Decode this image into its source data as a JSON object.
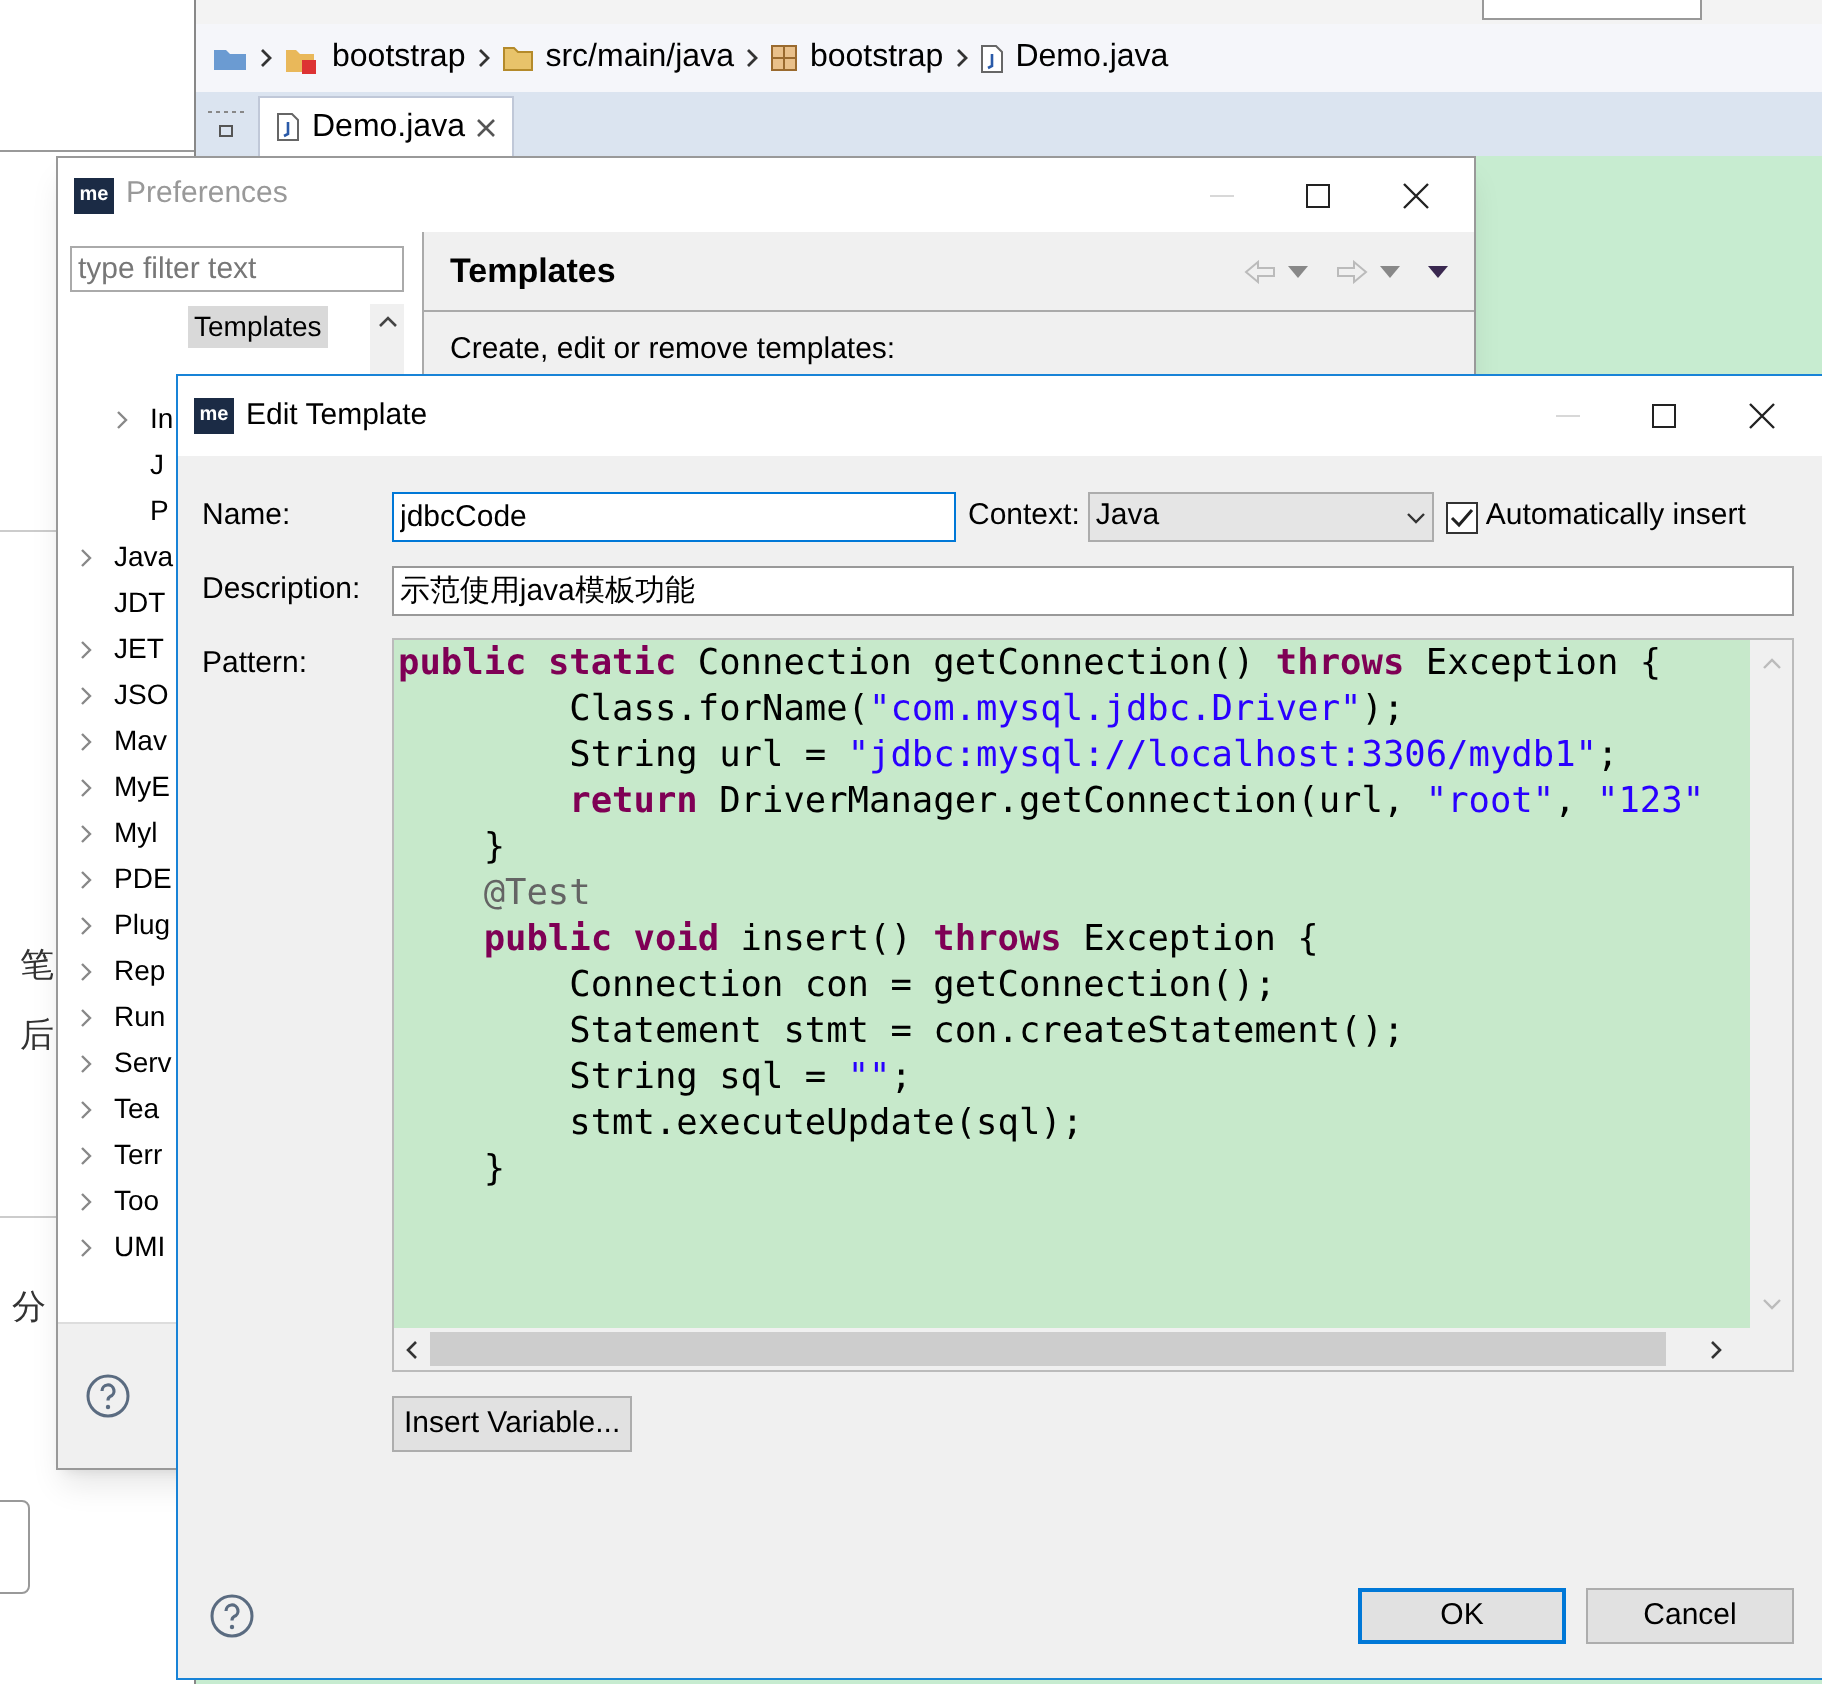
{
  "background_page": {
    "fragments": [
      "笔",
      "后",
      "分"
    ]
  },
  "editor": {
    "breadcrumb": [
      {
        "label": "bootstrap",
        "kind": "project"
      },
      {
        "label": "src/main/java",
        "kind": "folder"
      },
      {
        "label": "bootstrap",
        "kind": "package"
      },
      {
        "label": "Demo.java",
        "kind": "file"
      }
    ],
    "tabs": [
      {
        "label": "Demo.java",
        "selected": true
      }
    ]
  },
  "preferences": {
    "title": "Preferences",
    "app_icon_text": "me",
    "filter": {
      "placeholder": "type filter text"
    },
    "tree": {
      "branch": {
        "children": [
          {
            "label": "Templates",
            "selected": true,
            "expandable": false
          },
          {
            "label": "In",
            "selected": false,
            "expandable": true
          },
          {
            "label": "J",
            "selected": false,
            "expandable": false
          },
          {
            "label": "P",
            "selected": false,
            "expandable": false
          }
        ]
      },
      "items": [
        {
          "label": "Java",
          "selected": false,
          "expandable": true
        },
        {
          "label": "JDT",
          "selected": false,
          "expandable": false
        },
        {
          "label": "JET",
          "selected": false,
          "expandable": true
        },
        {
          "label": "JSO",
          "selected": false,
          "expandable": true
        },
        {
          "label": "Mav",
          "selected": false,
          "expandable": true
        },
        {
          "label": "MyE",
          "selected": false,
          "expandable": true
        },
        {
          "label": "Myl",
          "selected": false,
          "expandable": true
        },
        {
          "label": "PDE",
          "selected": false,
          "expandable": true
        },
        {
          "label": "Plug",
          "selected": false,
          "expandable": true
        },
        {
          "label": "Rep",
          "selected": false,
          "expandable": true
        },
        {
          "label": "Run",
          "selected": false,
          "expandable": true
        },
        {
          "label": "Serv",
          "selected": false,
          "expandable": true
        },
        {
          "label": "Tea",
          "selected": false,
          "expandable": true
        },
        {
          "label": "Terr",
          "selected": false,
          "expandable": true
        },
        {
          "label": "Too",
          "selected": false,
          "expandable": true
        },
        {
          "label": "UMI",
          "selected": false,
          "expandable": true
        }
      ]
    },
    "page_title": "Templates",
    "page_description": "Create, edit or remove templates:"
  },
  "edit_template": {
    "title": "Edit Template",
    "app_icon_text": "me",
    "name": {
      "label": "Name:",
      "value": "jdbcCode"
    },
    "context": {
      "label": "Context:",
      "value": "Java"
    },
    "auto_insert": {
      "label": "Automatically insert",
      "checked": true
    },
    "description": {
      "label": "Description:",
      "value": "示范使用java模板功能"
    },
    "pattern": {
      "label": "Pattern:",
      "lines": [
        [
          {
            "kind": "keyword",
            "text": "public"
          },
          {
            "kind": "keyword",
            "text": " static"
          },
          {
            "kind": "plain",
            "text": " Connection getConnection() "
          },
          {
            "kind": "keyword",
            "text": "throws"
          },
          {
            "kind": "plain",
            "text": " Exception {"
          }
        ],
        [
          {
            "kind": "plain",
            "text": "        Class.forName("
          },
          {
            "kind": "string",
            "text": "\"com.mysql.jdbc.Driver\""
          },
          {
            "kind": "plain",
            "text": ");"
          }
        ],
        [
          {
            "kind": "plain",
            "text": "        String url = "
          },
          {
            "kind": "string",
            "text": "\"jdbc:mysql://localhost:3306/mydb1\""
          },
          {
            "kind": "plain",
            "text": ";"
          }
        ],
        [
          {
            "kind": "keyword",
            "text": "        return"
          },
          {
            "kind": "plain",
            "text": " DriverManager.getConnection(url, "
          },
          {
            "kind": "string",
            "text": "\"root\""
          },
          {
            "kind": "plain",
            "text": ", "
          },
          {
            "kind": "string",
            "text": "\"123\""
          }
        ],
        [
          {
            "kind": "plain",
            "text": "    }"
          }
        ],
        [
          {
            "kind": "annotation",
            "text": "    @Test"
          }
        ],
        [
          {
            "kind": "keyword",
            "text": "    public"
          },
          {
            "kind": "keyword",
            "text": " void"
          },
          {
            "kind": "plain",
            "text": " insert() "
          },
          {
            "kind": "keyword",
            "text": "throws"
          },
          {
            "kind": "plain",
            "text": " Exception {"
          }
        ],
        [
          {
            "kind": "plain",
            "text": "        Connection con = getConnection();"
          }
        ],
        [
          {
            "kind": "plain",
            "text": "        Statement stmt = con.createStatement();"
          }
        ],
        [
          {
            "kind": "plain",
            "text": "        String sql = "
          },
          {
            "kind": "string",
            "text": "\"\""
          },
          {
            "kind": "plain",
            "text": ";"
          }
        ],
        [
          {
            "kind": "plain",
            "text": "        stmt.executeUpdate(sql);"
          }
        ],
        [
          {
            "kind": "plain",
            "text": "    }"
          }
        ]
      ]
    },
    "buttons": {
      "insert_variable": "Insert Variable...",
      "ok": "OK",
      "cancel": "Cancel"
    }
  }
}
